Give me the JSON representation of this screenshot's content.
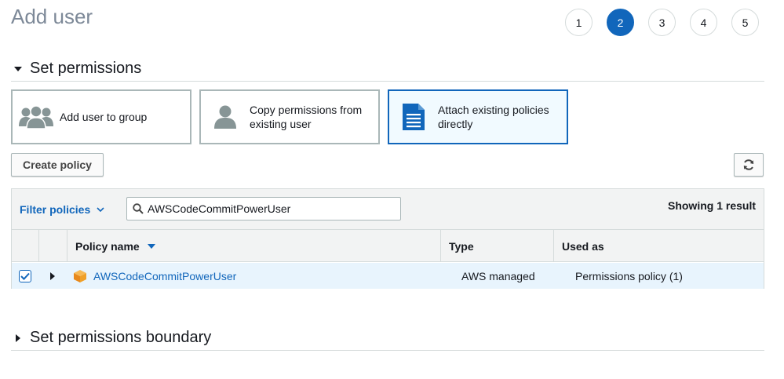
{
  "page": {
    "title": "Add user"
  },
  "steps": [
    "1",
    "2",
    "3",
    "4",
    "5"
  ],
  "active_step": "2",
  "permissions": {
    "section_title": "Set permissions",
    "options": [
      {
        "label": "Add user to group",
        "icon": "users-group-icon",
        "selected": false
      },
      {
        "label": "Copy permissions from existing user",
        "icon": "user-icon",
        "selected": false
      },
      {
        "label": "Attach existing policies directly",
        "icon": "document-icon",
        "selected": true
      }
    ],
    "create_policy_label": "Create policy",
    "refresh_icon": "refresh-icon"
  },
  "policy_table": {
    "filter_label": "Filter policies",
    "search_value": "AWSCodeCommitPowerUser",
    "showing": "Showing 1 result",
    "columns": {
      "name": "Policy name",
      "type": "Type",
      "used_as": "Used as"
    },
    "rows": [
      {
        "checked": true,
        "name": "AWSCodeCommitPowerUser",
        "type": "AWS managed",
        "used_as": "Permissions policy (1)"
      }
    ]
  },
  "boundary": {
    "section_title": "Set permissions boundary"
  },
  "colors": {
    "accent": "#1166bb",
    "selected_bg": "#f1faff",
    "row_selected": "#e8f4fd",
    "policy_icon": "#f0a028"
  }
}
